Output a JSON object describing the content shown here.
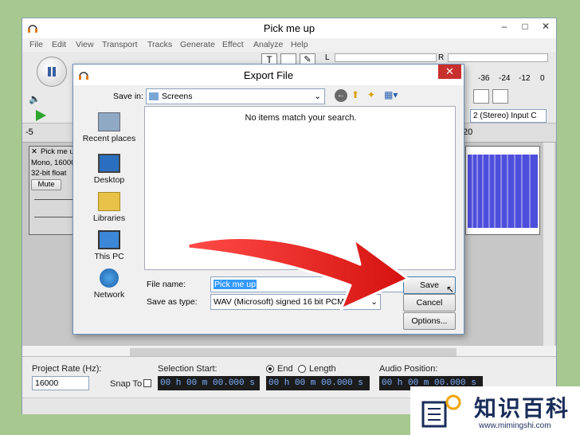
{
  "app": {
    "title": "Pick me up",
    "window_controls": [
      "–",
      "□",
      "✕"
    ]
  },
  "menu": [
    "File",
    "Edit",
    "View",
    "Transport",
    "Tracks",
    "Generate",
    "Effect",
    "Analyze",
    "Help"
  ],
  "toolbar": {
    "meter_ticks": [
      "-36",
      "-24",
      "-12",
      "0"
    ],
    "meter_l": "L",
    "meter_r": "R",
    "input_channels": "2 (Stereo) Input C"
  },
  "ruler": {
    "left_label": "-5",
    "right_label": "20"
  },
  "track": {
    "name": "Pick me up",
    "line1": "Mono, 16000",
    "line2": "32-bit float",
    "mute": "Mute"
  },
  "dialog": {
    "title": "Export File",
    "close": "✕",
    "save_in_label": "Save in:",
    "save_in_value": "Screens",
    "empty_message": "No items match your search.",
    "places": [
      "Recent places",
      "Desktop",
      "Libraries",
      "This PC",
      "Network"
    ],
    "file_name_label": "File name:",
    "file_name_value": "Pick me up",
    "save_type_label": "Save as type:",
    "save_type_value": "WAV (Microsoft) signed 16 bit PCM",
    "save_button": "Save",
    "cancel_button": "Cancel",
    "options_button": "Options..."
  },
  "selection": {
    "project_rate_label": "Project Rate (Hz):",
    "project_rate_value": "16000",
    "snap_to_label": "Snap To",
    "selection_start_label": "Selection Start:",
    "end_label": "End",
    "length_label": "Length",
    "audio_position_label": "Audio Position:",
    "time_value": "00 h 00 m 00.000 s"
  },
  "watermark": {
    "name": "知识百科",
    "url": "www.mimingshi.com"
  },
  "colors": {
    "accent_red": "#e3211f",
    "wave_blue": "#3b3bd8",
    "time_text": "#7fb2ff"
  }
}
